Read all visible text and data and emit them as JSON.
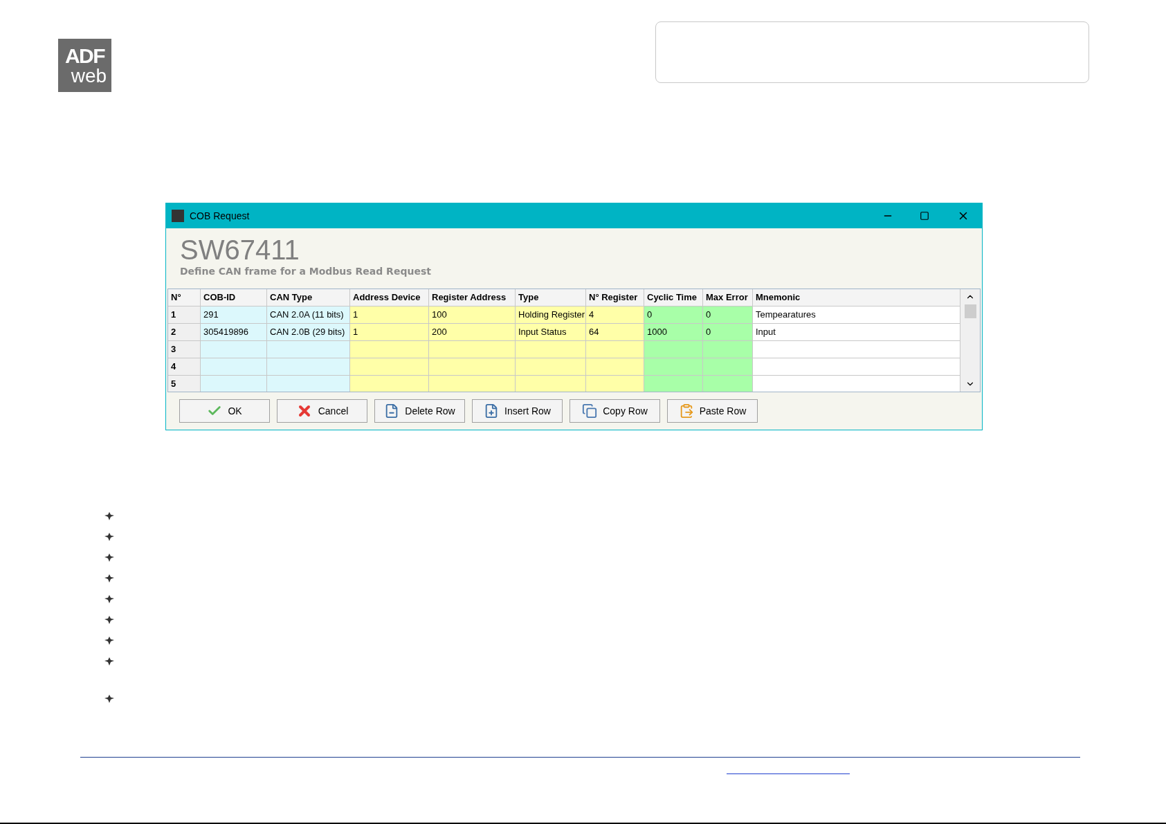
{
  "logo": {
    "top": "ADF",
    "bottom": "web"
  },
  "window": {
    "title": "COB Request",
    "heading": "SW67411",
    "subtitle": "Define CAN frame for a Modbus Read Request"
  },
  "table": {
    "columns": [
      {
        "label": "N°",
        "color": "#f0f0f0"
      },
      {
        "label": "COB-ID",
        "color": "#dcf8fc"
      },
      {
        "label": "CAN Type",
        "color": "#dcf8fc"
      },
      {
        "label": "Address Device",
        "color": "#ffffa8"
      },
      {
        "label": "Register Address",
        "color": "#ffffa8"
      },
      {
        "label": "Type",
        "color": "#ffffa8"
      },
      {
        "label": "N° Register",
        "color": "#ffffa8"
      },
      {
        "label": "Cyclic Time",
        "color": "#a8ffa8"
      },
      {
        "label": "Max Error",
        "color": "#a8ffa8"
      },
      {
        "label": "Mnemonic",
        "color": "#ffffff"
      }
    ],
    "rows": [
      {
        "n": "1",
        "cells": [
          "291",
          "CAN 2.0A (11 bits)",
          "1",
          "100",
          "Holding Register",
          "4",
          "0",
          "0",
          "Tempearatures"
        ]
      },
      {
        "n": "2",
        "cells": [
          "305419896",
          "CAN 2.0B (29 bits)",
          "1",
          "200",
          "Input Status",
          "64",
          "1000",
          "0",
          "Input"
        ]
      },
      {
        "n": "3"
      },
      {
        "n": "4"
      },
      {
        "n": "5"
      }
    ]
  },
  "buttons": [
    {
      "label": "OK",
      "kind": "ok"
    },
    {
      "label": "Cancel",
      "kind": "cancel"
    },
    {
      "label": "Delete Row",
      "kind": "delete"
    },
    {
      "label": "Insert Row",
      "kind": "insert"
    },
    {
      "label": "Copy Row",
      "kind": "copy"
    },
    {
      "label": "Paste Row",
      "kind": "paste"
    }
  ]
}
